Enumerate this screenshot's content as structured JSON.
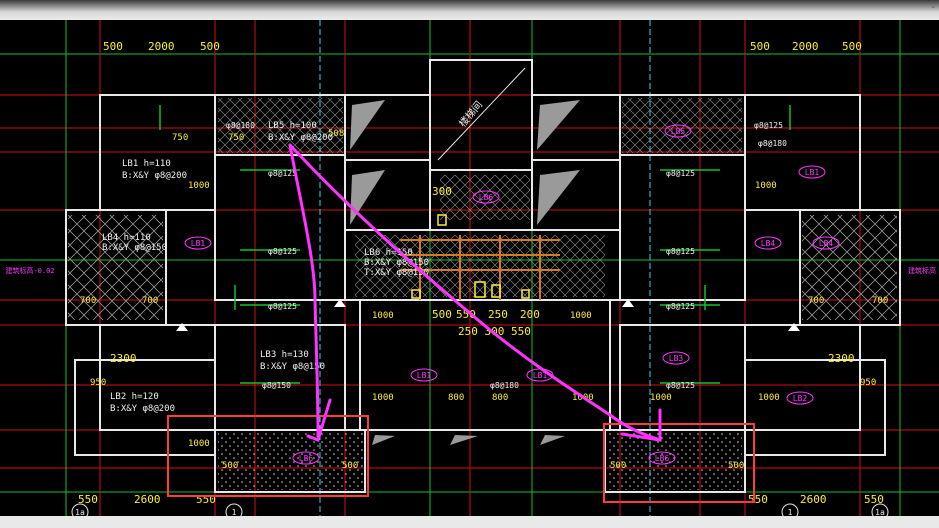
{
  "window": {
    "corner_mark": "-"
  },
  "dimensions": {
    "top_left": [
      "500",
      "2000",
      "500"
    ],
    "top_right": [
      "500",
      "2000",
      "500"
    ],
    "bottom_left": [
      "550",
      "2600",
      "550"
    ],
    "bottom_right": [
      "550",
      "2600",
      "550"
    ],
    "left_room": "2300",
    "right_room": "2300",
    "mid_bottom": [
      "500",
      "550",
      "250",
      "200",
      "1000"
    ],
    "mid_under": "250  300  550",
    "misc": [
      "750",
      "750",
      "508",
      "1000",
      "1000",
      "300",
      "950",
      "950",
      "1000",
      "1000",
      "800",
      "800",
      "1000",
      "700",
      "700",
      "700",
      "700",
      "500",
      "500",
      "500",
      "500",
      "1000",
      "1000",
      "1000"
    ]
  },
  "slab_labels": {
    "lb5_note": [
      "LB5 h=100",
      "B:X&Y φ8@200"
    ],
    "lb1_note": [
      "LB1 h=110",
      "B:X&Y φ8@200"
    ],
    "lb4_note": [
      "LB4 h=110",
      "B:X&Y φ8@150"
    ],
    "lb6_note": [
      "LB6 h=150",
      "B:X&Y φ8@150",
      "T:X&Y φ8@150"
    ],
    "lb3_note": [
      "LB3 h=130",
      "B:X&Y φ8@150"
    ],
    "lb2_note": [
      "LB2 h=120",
      "B:X&Y φ8@200"
    ],
    "tags": [
      "LB1",
      "LB1",
      "LB5",
      "LB6",
      "LB1",
      "LB1",
      "LB3",
      "LB2",
      "LB6",
      "LB6",
      "LB4",
      "LB4"
    ],
    "stair_tag": "楼梯间"
  },
  "rebar_labels": {
    "r1": "φ8@180",
    "r2": "φ8@125",
    "r3": "φ8@125",
    "r4": "φ8@125",
    "r5": "φ8@125",
    "r6": "φ8@125",
    "r7": "φ8@125",
    "r8": "φ8@150",
    "r9": "φ8@180",
    "r10": "φ8@125",
    "r11": "φ8@125",
    "r12": "φ8@180"
  },
  "axis_labels": {
    "bottom_left": "1a",
    "bottom_mid_left": "1",
    "bottom_mid_right": "1",
    "bottom_right": "1a"
  },
  "side_notes": {
    "left": "建筑标高-0.02",
    "right": "建筑标高"
  },
  "colors": {
    "background": "#000000",
    "annotation": "#ff33ff",
    "highlight_box": "#ff3b3b",
    "grid_red": "#d01010",
    "grid_green": "#12c12c",
    "wall_white": "#e8e8e8",
    "cyan": "#2fd7e8",
    "yellow": "#ffee33"
  }
}
